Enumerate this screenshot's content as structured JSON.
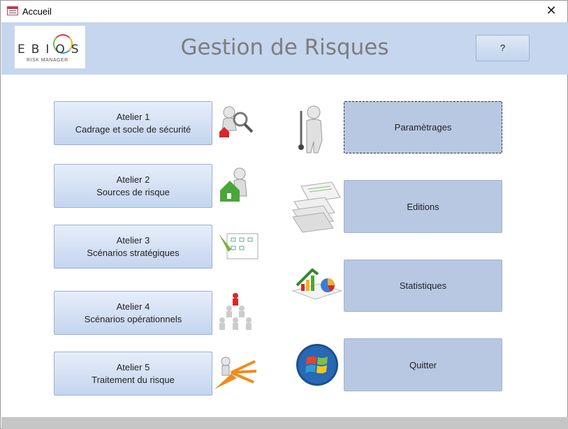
{
  "window": {
    "title": "Accueil",
    "close_glyph": "✕"
  },
  "header": {
    "title": "Gestion de Risques",
    "logo_word": "EBIOS",
    "logo_sub": "RISK MANAGER",
    "help_label": "?"
  },
  "ateliers": [
    {
      "line1": "Atelier 1",
      "line2": "Cadrage et socle de sécurité",
      "icon": "person-magnifier-house-icon"
    },
    {
      "line1": "Atelier 2",
      "line2": "Sources de risque",
      "icon": "person-house-icon"
    },
    {
      "line1": "Atelier 3",
      "line2": "Scénarios stratégiques",
      "icon": "pen-checklist-icon"
    },
    {
      "line1": "Atelier 4",
      "line2": "Scénarios opérationnels",
      "icon": "people-pyramid-icon"
    },
    {
      "line1": "Atelier 5",
      "line2": "Traitement du risque",
      "icon": "person-arrows-icon"
    }
  ],
  "side": [
    {
      "label": "Paramètrages",
      "icon": "person-tools-icon"
    },
    {
      "label": "Editions",
      "icon": "paper-stack-icon"
    },
    {
      "label": "Statistiques",
      "icon": "charts-icon"
    },
    {
      "label": "Quitter",
      "icon": "windows-logo-icon"
    }
  ],
  "colors": {
    "header_bg": "#c5d6ee",
    "button_bg": "#b8c8e3",
    "title_text": "#7d7d7d"
  }
}
